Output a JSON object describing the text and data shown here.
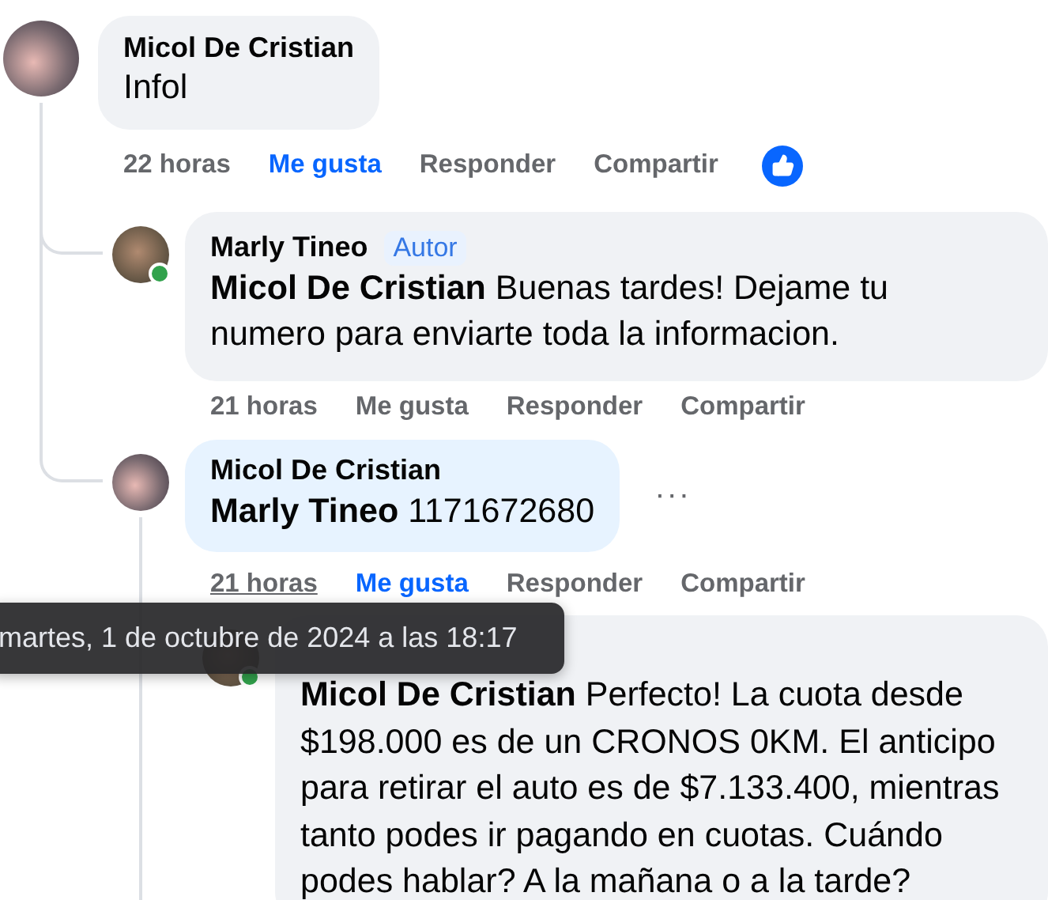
{
  "comments": [
    {
      "author": "Micol De Cristian",
      "text": "Infol",
      "time": "22 horas",
      "time_hovered": false,
      "like_label": "Me gusta",
      "liked": true,
      "reply_label": "Responder",
      "share_label": "Compartir",
      "has_reactions": true,
      "replies": [
        {
          "author": "Marly Tineo",
          "badge": "Autor",
          "online": true,
          "mention": "Micol De Cristian",
          "text": "Buenas tardes! Dejame tu numero para enviarte toda la informacion.",
          "time": "21 horas",
          "time_hovered": false,
          "like_label": "Me gusta",
          "liked": false,
          "reply_label": "Responder",
          "share_label": "Compartir"
        },
        {
          "author": "Micol De Cristian",
          "mention": "Marly Tineo",
          "text": "1171672680",
          "time": "21 horas",
          "time_hovered": true,
          "like_label": "Me gusta",
          "liked": true,
          "reply_label": "Responder",
          "share_label": "Compartir",
          "more_button": "···",
          "replies": [
            {
              "online": true,
              "mention": "Micol De Cristian",
              "text": "Perfecto! La cuota desde $198.000 es de un CRONOS 0KM. El anticipo para retirar el auto es de $7.133.400, mientras tanto podes ir pagando en cuotas. Cuándo podes hablar? A la mañana o a la tarde?"
            }
          ]
        }
      ]
    }
  ],
  "tooltip": "martes, 1 de octubre de 2024 a las 18:17"
}
